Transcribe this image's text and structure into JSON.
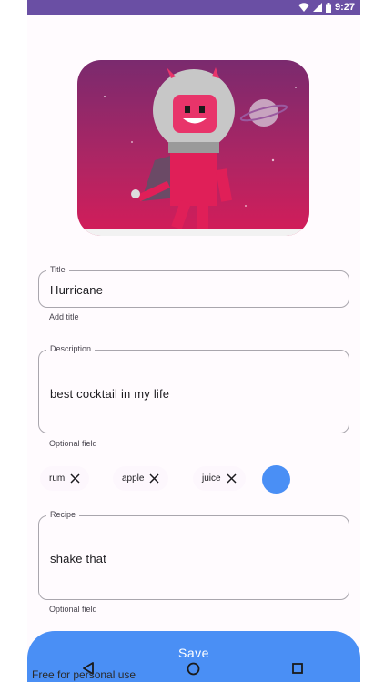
{
  "status_bar": {
    "time": "9:27"
  },
  "image": {
    "alt": ""
  },
  "title_field": {
    "label": "Title",
    "value": "Hurricane",
    "helper": "Add title"
  },
  "description_field": {
    "label": "Description",
    "value": "best cocktail in my life",
    "helper": "Optional field"
  },
  "chips": [
    {
      "label": "rum"
    },
    {
      "label": "apple"
    },
    {
      "label": "juice"
    }
  ],
  "recipe_field": {
    "label": "Recipe",
    "value": "shake that",
    "helper": "Optional field"
  },
  "save_button": {
    "label": "Save"
  },
  "watermark": "Free for personal use",
  "colors": {
    "status_bar": "#6a4fa4",
    "accent": "#4a8ff5",
    "outline": "#a9a6ad"
  }
}
